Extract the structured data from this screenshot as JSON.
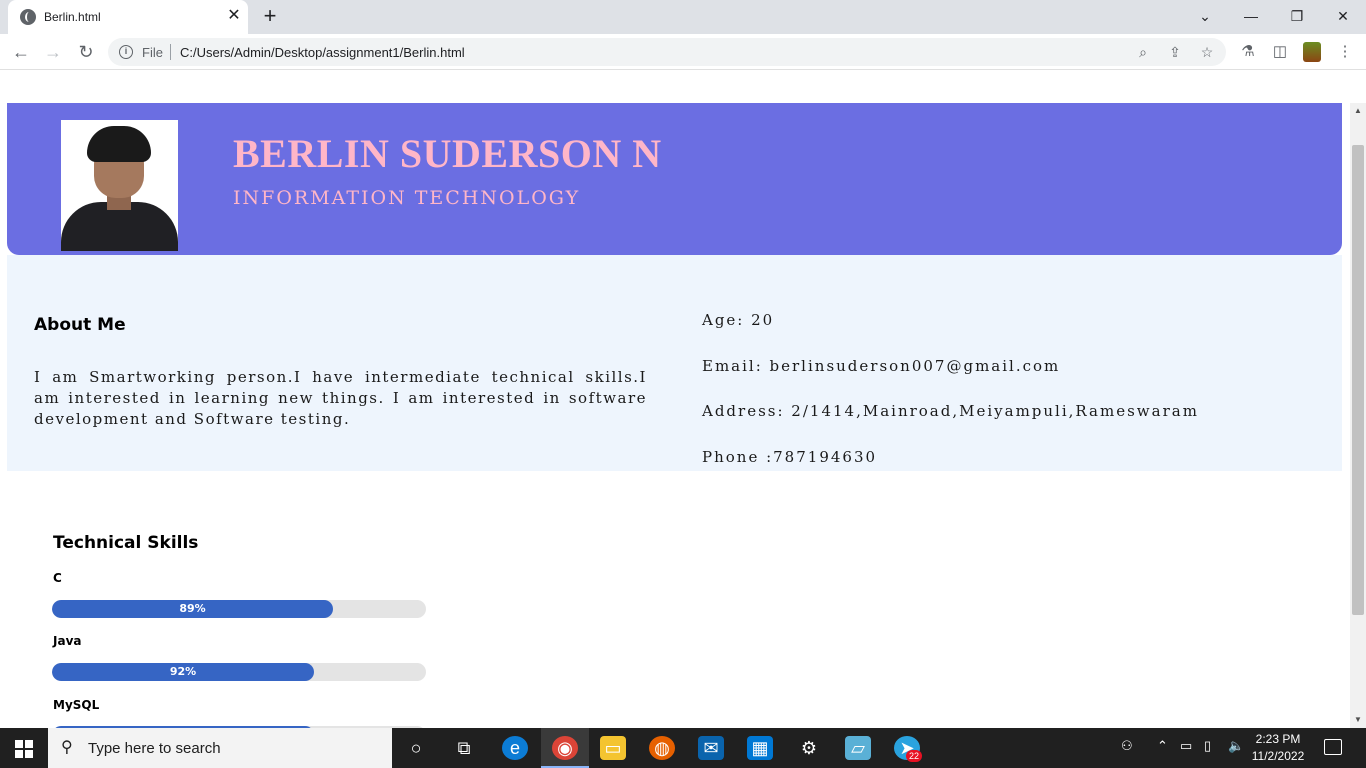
{
  "browser": {
    "tab_title": "Berlin.html",
    "url_scheme": "File",
    "url": "C:/Users/Admin/Desktop/assignment1/Berlin.html"
  },
  "page": {
    "name": "BERLIN SUDERSON N",
    "department": "INFORMATION TECHNOLOGY",
    "about_title": "About Me",
    "about_text": "I am Smartworking person.I have intermediate technical skills.I am interested in learning new things. I am interested in software development and Software testing.",
    "age": "Age: 20",
    "email": "Email: berlinsuderson007@gmail.com",
    "address": "Address: 2/1414,Mainroad,Meiyampuli,Rameswaram",
    "phone": "Phone :787194630",
    "skills_title": "Technical Skills",
    "skills": [
      {
        "name": "C",
        "label": "89%",
        "fill_fraction": 0.75
      },
      {
        "name": "Java",
        "label": "92%",
        "fill_fraction": 0.7
      },
      {
        "name": "MySQL",
        "label": "",
        "fill_fraction": 0.7
      }
    ]
  },
  "taskbar": {
    "search_placeholder": "Type here to search",
    "time": "2:23 PM",
    "date": "11/2/2022",
    "telegram_badge": "22"
  },
  "colors": {
    "header_bg": "#6b6ee2",
    "name_color": "#ffb6c8",
    "about_bg": "#eef5fd",
    "bar_fill": "#3665c4",
    "bar_track": "#e4e4e4"
  }
}
